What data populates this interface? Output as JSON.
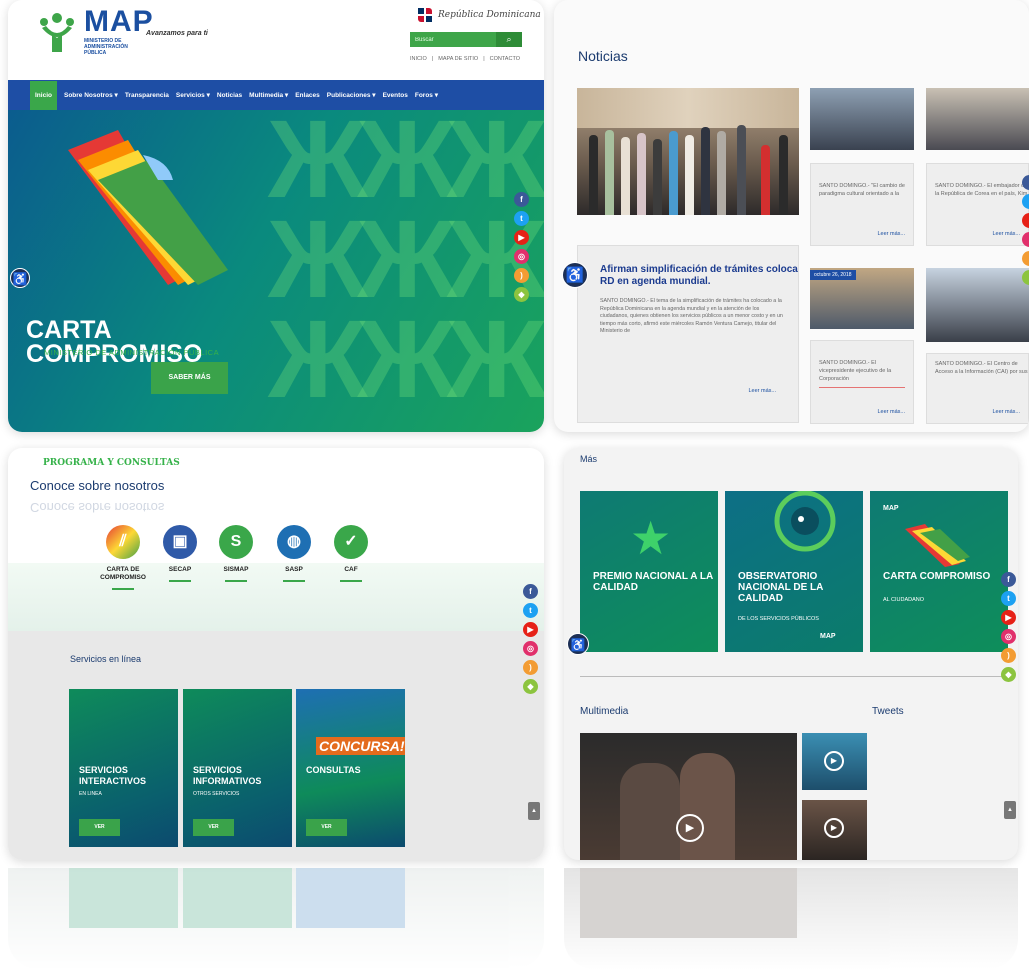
{
  "header": {
    "logo_text": "MAP",
    "logo_sub": "MINISTERIO DE ADMINISTRACIÓN PÚBLICA",
    "slogan": "Avanzamos para ti",
    "country": "República Dominicana",
    "search_placeholder": "Buscar",
    "top_links": [
      "INICIO",
      "|",
      "MAPA DE SITIO",
      "|",
      "CONTACTO"
    ]
  },
  "nav": {
    "items": [
      "Inicio",
      "Sobre Nosotros ▾",
      "Transparencia",
      "Servicios ▾",
      "Noticias",
      "Multimedia ▾",
      "Enlaces",
      "Publicaciones ▾",
      "Eventos",
      "Foros ▾"
    ]
  },
  "hero": {
    "title_1": "CARTA",
    "title_2": "COMPROMISO",
    "subtitle": "MINISTERIO DE ADMINISTRACIÓN PÚBLICA",
    "button": "SABER MÁS"
  },
  "noticias": {
    "title": "Noticias",
    "main_headline": "Afirman simplificación de trámites coloca RD en agenda mundial.",
    "main_body": "SANTO DOMINGO.- El tema de la simplificación de trámites ha colocado a la República Dominicana en la agenda mundial y en la atención de los ciudadanos, quienes obtienen los servicios públicos a un menor costo y en un tiempo más corto, afirmó este miércoles Ramón Ventura Camejo, titular del Ministerio de",
    "read_more": "Leer más...",
    "card_1": "SANTO DOMINGO.- \"El cambio de paradigma cultural orientado a la",
    "card_2": "SANTO DOMINGO.- El embajador de la República de Corea en el país, Kim",
    "card_3": "SANTO DOMINGO.- El vicepresidente ejecutivo de la Corporación",
    "card_4": "SANTO DOMINGO.- El Centro de Acceso a la Información (CAI) por sus",
    "date_label": "octubre 26, 2018"
  },
  "programs": {
    "heading": "PROGRAMA Y CONSULTAS",
    "subheading": "Conoce sobre nosotros",
    "items": [
      "CARTA DE COMPROMISO",
      "SECAP",
      "SISMAP",
      "SASP",
      "CAF"
    ]
  },
  "services": {
    "title": "Servicios en línea",
    "tiles": [
      {
        "title": "SERVICIOS INTERACTIVOS",
        "sub": "EN LINEA",
        "button": "VER"
      },
      {
        "title": "SERVICIOS INFORMATIVOS",
        "sub": "OTROS SERVICIOS",
        "button": "VER"
      },
      {
        "title": "CONSULTAS",
        "sub": "",
        "button": "VER",
        "badge": "CONCURSA!!"
      }
    ]
  },
  "mas": {
    "title": "Más",
    "tiles": [
      {
        "title": "PREMIO NACIONAL A LA CALIDAD",
        "sub": ""
      },
      {
        "title": "OBSERVATORIO NACIONAL DE LA CALIDAD",
        "sub": "DE LOS SERVICIOS PÚBLICOS",
        "brand": "MAP"
      },
      {
        "title": "CARTA COMPROMISO",
        "sub": "AL CIUDADANO",
        "brand": "MAP"
      }
    ],
    "multimedia": "Multimedia",
    "tweets": "Tweets"
  },
  "colors": {
    "nav": "#1e4ea5",
    "accent": "#3aa74a",
    "title_blue": "#1b3b6f"
  },
  "icons": [
    "facebook-icon",
    "twitter-icon",
    "youtube-icon",
    "instagram-icon",
    "rss-icon",
    "android-icon",
    "accessibility-icon",
    "play-icon",
    "search-icon"
  ]
}
